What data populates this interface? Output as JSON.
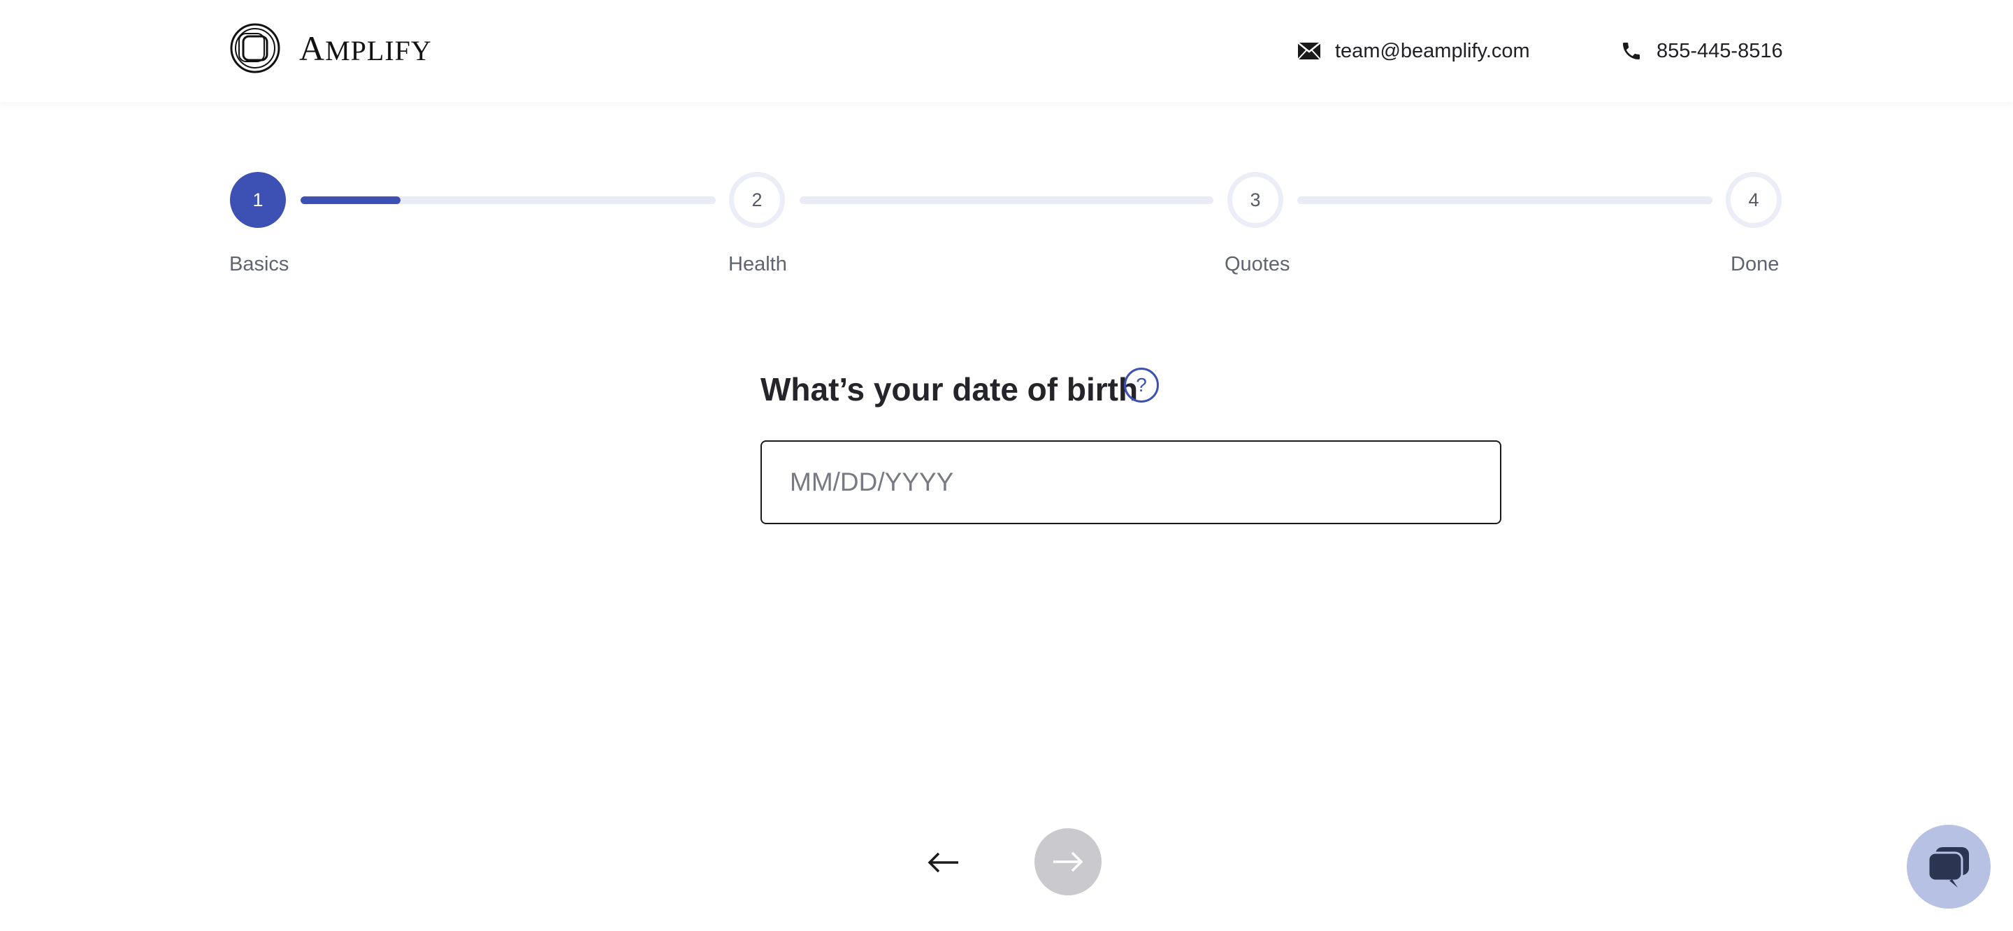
{
  "header": {
    "logo_first_letter": "A",
    "logo_rest": "MPLIFY",
    "email": "team@beamplify.com",
    "phone": "855-445-8516",
    "email_icon": "envelope-icon",
    "phone_icon": "phone-icon"
  },
  "stepper": {
    "steps": [
      {
        "number": "1",
        "label": "Basics",
        "state": "active"
      },
      {
        "number": "2",
        "label": "Health",
        "state": "inactive"
      },
      {
        "number": "3",
        "label": "Quotes",
        "state": "inactive"
      },
      {
        "number": "4",
        "label": "Done",
        "state": "inactive"
      }
    ],
    "progress_fraction_step1": 0.24
  },
  "form": {
    "question": "What’s your date of birth",
    "help_icon_glyph": "?",
    "dob_placeholder": "MM/DD/YYYY",
    "dob_value": ""
  },
  "nav": {
    "back_icon": "arrow-left-icon",
    "next_icon": "arrow-right-icon",
    "chat_icon": "chat-bubbles-icon"
  },
  "colors": {
    "accent": "#3d50b3",
    "track": "#e9ebf5",
    "next_disabled": "#c9c9ce",
    "chat_bg": "#b6c1e4"
  }
}
